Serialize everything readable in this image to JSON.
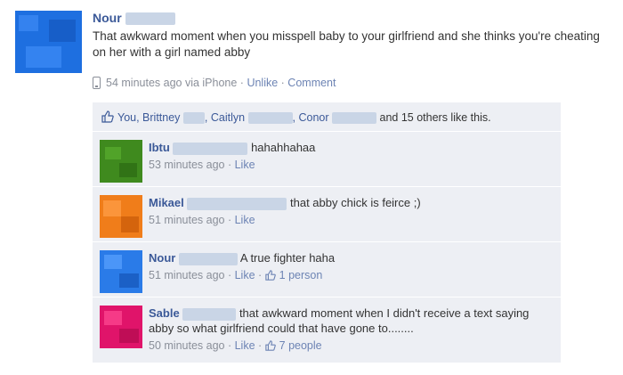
{
  "post": {
    "author": "Nour",
    "text": "That awkward moment when you misspell baby to your girlfriend and she thinks you're cheating on her with a girl named abby",
    "time": "54 minutes ago via iPhone",
    "sep": " · ",
    "unlike": "Unlike",
    "comment": "Comment"
  },
  "likes": {
    "you": "You, Brittney",
    "caitlyn": ", Caitlyn",
    "conor": ", Conor",
    "rest": "and 15 others like this."
  },
  "comments": [
    {
      "author": "Ibtu",
      "text": "hahahhahaa",
      "time": "53 minutes ago",
      "like": "Like",
      "likes": ""
    },
    {
      "author": "Mikael",
      "text": "that abby chick is feirce ;)",
      "time": "51 minutes ago",
      "like": "Like",
      "likes": ""
    },
    {
      "author": "Nour",
      "text": "A true fighter haha",
      "time": "51 minutes ago",
      "like": "Like",
      "likes": "1 person"
    },
    {
      "author": "Sable",
      "text": "that awkward moment when I didn't receive a text saying abby so what girlfriend could that have gone to........",
      "time": "50 minutes ago",
      "like": "Like",
      "likes": "7 people"
    }
  ],
  "colors": {
    "post_avatar": "#1e6fe0",
    "ibtu_avatar": "#3f8a1e",
    "mikael_avatar": "#f07d1a",
    "nour_avatar": "#2a7be8",
    "sable_avatar": "#e0146a",
    "link": "#3b5998",
    "meta": "#8a8f99",
    "panel": "#edeff4"
  }
}
